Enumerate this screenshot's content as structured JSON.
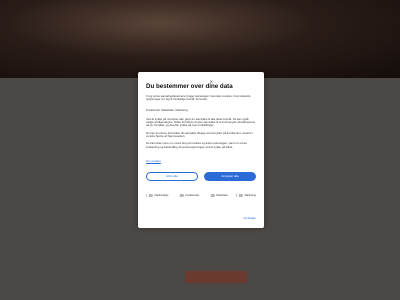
{
  "modal": {
    "title": "Du bestemmer over dine data",
    "intro": "Vi og vores samarbejdspartnere bruger teknologier, herunder cookies, til at indsamle oplysninger om dig til forskellige formål, herunder:",
    "categories": "Funktionelt, Statistiske, Marketing",
    "body": "Ved at trykke på 'Accepter alle' giver du samtykke til alle disse formål. Du kan også vælge at tilkendegive, hvilke formål du vil give samtykke til ved at benytte checkboksene ud for formålet, og derefter trykke på 'Gem indstillinger'.",
    "body_2": "Du kan til enhver tid trække dit samtykke tilbage ved at trykke på det lille ikon nederst i venstre hjørne af hjemmesiden.",
    "body_3": "Du kan læse mere om vores brug af cookies og andre teknologier, samt om vores indsamling og behandling af personoplysninger ved at trykke på linket.",
    "read_more": "Om cookies",
    "deny_label": "Afvis alle",
    "accept_label": "Accepter alle",
    "toggles": [
      {
        "label": "Nødvendige"
      },
      {
        "label": "Funktionelle"
      },
      {
        "label": "Statistiske"
      },
      {
        "label": "Marketing"
      }
    ],
    "details_label": "Vis detaljer"
  },
  "colors": {
    "accent": "#2a6bd6",
    "overlay": "#4c4846"
  }
}
